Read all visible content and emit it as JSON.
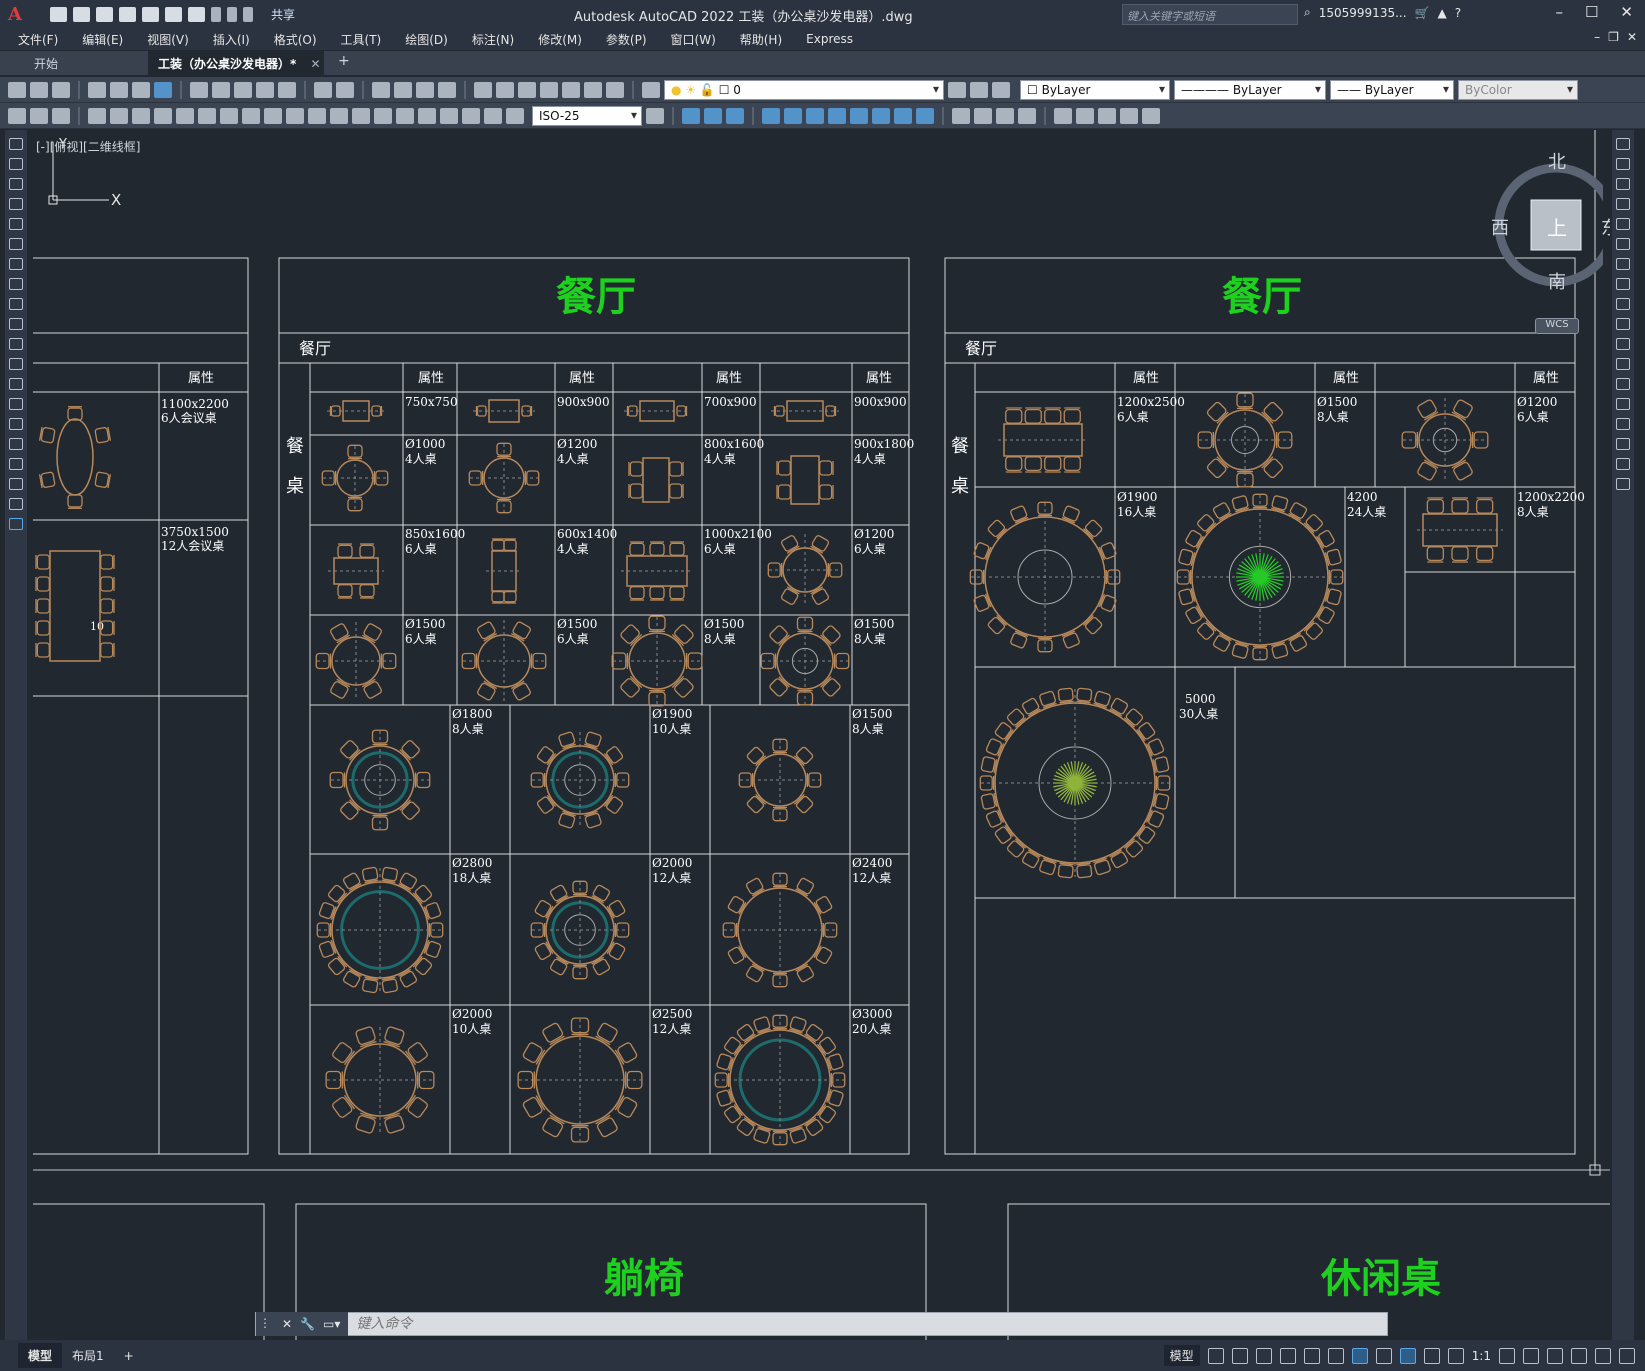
{
  "app": {
    "logo": "A",
    "title": "Autodesk AutoCAD 2022    工装（办公桌沙发电器）.dwg",
    "share_label": "共享",
    "search_placeholder": "键入关键字或短语",
    "user": "1505999135...",
    "window_controls": [
      "–",
      "☐",
      "✕"
    ]
  },
  "menu": [
    "文件(F)",
    "编辑(E)",
    "视图(V)",
    "插入(I)",
    "格式(O)",
    "工具(T)",
    "绘图(D)",
    "标注(N)",
    "修改(M)",
    "参数(P)",
    "窗口(W)",
    "帮助(H)",
    "Express"
  ],
  "tabs": {
    "start": "开始",
    "doc": "工装（办公桌沙发电器）*",
    "close": "✕",
    "plus": "+"
  },
  "toolbar": {
    "layer_value": "0",
    "color": "ByLayer",
    "linetype": "ByLayer",
    "lineweight": "ByLayer",
    "plotstyle": "ByColor",
    "dimstyle": "ISO-25"
  },
  "viewport_label": "[-][俯视][二维线框]",
  "viewcube": {
    "n": "北",
    "s": "南",
    "e": "东",
    "w": "西",
    "face": "上",
    "wcs": "WCS"
  },
  "ucs": {
    "x": "X",
    "y": "Y"
  },
  "drawing": {
    "left_partial": {
      "attr": "属性",
      "cells": [
        [
          "1100x2200",
          "6人会议桌"
        ],
        [
          "3750x1500",
          "12人会议桌"
        ]
      ],
      "fragment": "10"
    },
    "panel1": {
      "title": "餐厅",
      "subtitle": "餐厅",
      "side": [
        "餐",
        "桌"
      ],
      "attr": "属性",
      "grid": [
        [
          [
            "750x750",
            ""
          ],
          [
            "900x900",
            ""
          ],
          [
            "700x900",
            ""
          ],
          [
            "900x900",
            ""
          ]
        ],
        [
          [
            "Ø1000",
            "4人桌"
          ],
          [
            "Ø1200",
            "4人桌"
          ],
          [
            "800x1600",
            "4人桌"
          ],
          [
            "900x1800",
            "4人桌"
          ]
        ],
        [
          [
            "850x1600",
            "6人桌"
          ],
          [
            "600x1400",
            "4人桌"
          ],
          [
            "1000x2100",
            "6人桌"
          ],
          [
            "Ø1200",
            "6人桌"
          ]
        ],
        [
          [
            "Ø1500",
            "6人桌"
          ],
          [
            "Ø1500",
            "6人桌"
          ],
          [
            "Ø1500",
            "8人桌"
          ],
          [
            "Ø1500",
            "8人桌"
          ]
        ]
      ],
      "big": [
        [
          [
            "Ø1800",
            "8人桌"
          ],
          [
            "Ø1900",
            "10人桌"
          ],
          [
            "Ø1500",
            "8人桌"
          ]
        ],
        [
          [
            "Ø2800",
            "18人桌"
          ],
          [
            "Ø2000",
            "12人桌"
          ],
          [
            "Ø2400",
            "12人桌"
          ]
        ],
        [
          [
            "Ø2000",
            "10人桌"
          ],
          [
            "Ø2500",
            "12人桌"
          ],
          [
            "Ø3000",
            "20人桌"
          ]
        ]
      ]
    },
    "panel2": {
      "title": "餐厅",
      "subtitle": "餐厅",
      "side": [
        "餐",
        "桌"
      ],
      "attr": "属性",
      "row1": [
        [
          "1200x2500",
          "6人桌"
        ],
        [
          "Ø1500",
          "8人桌"
        ],
        [
          "Ø1200",
          "6人桌"
        ]
      ],
      "row2": [
        [
          "Ø1900",
          "16人桌"
        ],
        [
          "4200",
          "24人桌"
        ],
        [
          "1200x2200",
          "8人桌"
        ]
      ],
      "row3": [
        [
          "5000",
          "30人桌"
        ]
      ]
    },
    "bottom_titles": {
      "recliner": "躺椅",
      "leisure": "休闲桌"
    }
  },
  "command": {
    "placeholder": "键入命令",
    "close": "✕"
  },
  "status": {
    "tabs": [
      "模型",
      "布局1"
    ],
    "plus": "+",
    "model": "模型",
    "scale": "1:1"
  },
  "colors": {
    "line": "#d8d8d8",
    "title_green": "#1fd11f",
    "furniture": "#b8895a",
    "plant": "#27c927",
    "teal": "#1d6c6c"
  }
}
